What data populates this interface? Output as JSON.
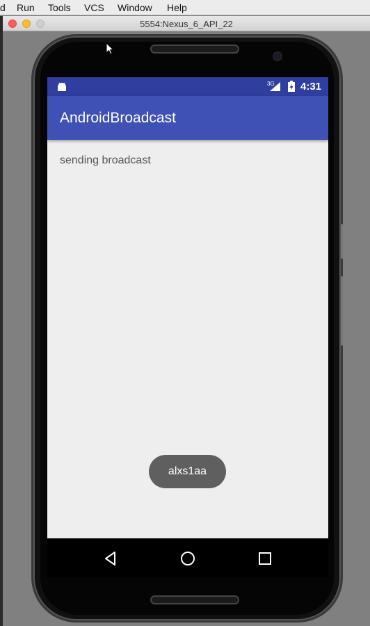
{
  "menubar": {
    "items": [
      "Run",
      "Tools",
      "VCS",
      "Window",
      "Help"
    ],
    "partial_first": "d"
  },
  "window": {
    "title": "5554:Nexus_6_API_22"
  },
  "statusbar": {
    "network": "3G",
    "time": "4:31",
    "color": "#303f9f"
  },
  "app": {
    "title": "AndroidBroadcast",
    "primary_color": "#3f51b5",
    "body_text": "sending broadcast"
  },
  "toast": {
    "text": "alxs1aa"
  },
  "navbar": {
    "buttons": [
      "back-icon",
      "home-icon",
      "recents-icon"
    ]
  }
}
